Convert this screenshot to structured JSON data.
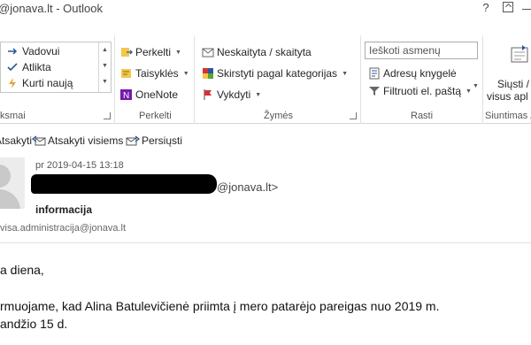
{
  "window": {
    "title": "@jonava.lt - Outlook",
    "help": "?"
  },
  "ribbon": {
    "quick_steps": {
      "items": [
        "Vadovui",
        "Atlikta",
        "Kurti naują"
      ],
      "label": "ksmai"
    },
    "move": {
      "items": [
        "Perkelti",
        "Taisyklės",
        "OneNote"
      ],
      "label": "Perkelti"
    },
    "tags": {
      "items": [
        "Neskaityta / skaityta",
        "Skirstyti pagal kategorijas",
        "Vykdyti"
      ],
      "label": "Žymės"
    },
    "find": {
      "search_placeholder": "Ieškoti asmenų",
      "address_book": "Adresų knygelė",
      "filter": "Filtruoti el. paštą",
      "label": "Rasti"
    },
    "send_receive": {
      "line1": "Siųsti /",
      "line2": "visus apl",
      "label": "Siuntimas /"
    }
  },
  "actions": {
    "reply": "Atsakyti",
    "reply_all": "Atsakyti visiems",
    "forward": "Persiųsti"
  },
  "message": {
    "date": "pr 2019-04-15 13:18",
    "sender_tail": "@jonava.lt>",
    "subject": "informacija",
    "to": "visa.administracija@jonava.lt",
    "body": [
      "a diena,",
      "rmuojame, kad Alina Batulevičienė priimta  į mero patarėjo pareigas nuo 2019 m.",
      "andžio 15 d."
    ]
  },
  "colors": {
    "accent": "#2b579a",
    "flag": "#d13438",
    "onenote": "#7719aa"
  }
}
